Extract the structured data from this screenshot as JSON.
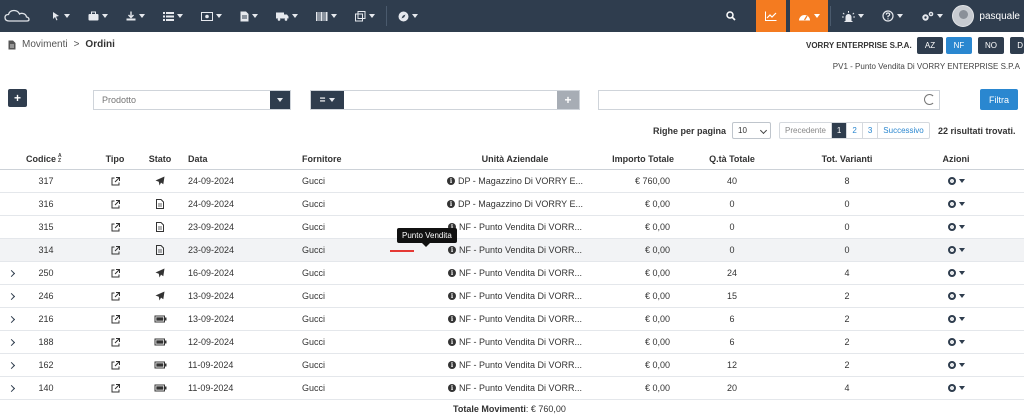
{
  "nav": {
    "user_name": "pasquale"
  },
  "breadcrumb": {
    "parent": "Movimenti",
    "separator": ">",
    "current": "Ordini"
  },
  "company": {
    "name": "VORRY ENTERPRISE S.P.A.",
    "store": "PV1 - Punto Vendita Di VORRY ENTERPRISE S.P.A",
    "buttons": [
      "AZ",
      "NF",
      "NO",
      "D"
    ]
  },
  "filters": {
    "add_label": "+",
    "product_placeholder": "Prodotto",
    "operator_label": "=",
    "plus_label": "+",
    "filter_button": "Filtra"
  },
  "pagination": {
    "rows_label": "Righe per pagina",
    "rows_value": "10",
    "prev_label": "Precedente",
    "pages": [
      "1",
      "2",
      "3"
    ],
    "next_label": "Successivo",
    "results_text": "22 risultati trovati."
  },
  "table": {
    "columns": {
      "codice": "Codice",
      "tipo": "Tipo",
      "stato": "Stato",
      "data": "Data",
      "fornitore": "Fornitore",
      "unita": "Unità Aziendale",
      "importo": "Importo Totale",
      "qta": "Q.tà Totale",
      "varianti": "Tot. Varianti",
      "azioni": "Azioni"
    },
    "rows": [
      {
        "codice": "317",
        "stato": "send",
        "data": "24-09-2024",
        "fornitore": "Gucci",
        "unita": "DP - Magazzino Di VORRY E...",
        "importo": "€ 760,00",
        "qta": "40",
        "varianti": "8",
        "expandable": false
      },
      {
        "codice": "316",
        "stato": "document",
        "data": "24-09-2024",
        "fornitore": "Gucci",
        "unita": "DP - Magazzino Di VORRY E...",
        "importo": "€ 0,00",
        "qta": "0",
        "varianti": "0",
        "expandable": false
      },
      {
        "codice": "315",
        "stato": "document",
        "data": "23-09-2024",
        "fornitore": "Gucci",
        "unita": "NF - Punto Vendita Di VORR...",
        "importo": "€ 0,00",
        "qta": "0",
        "varianti": "0",
        "expandable": false
      },
      {
        "codice": "314",
        "stato": "document",
        "data": "23-09-2024",
        "fornitore": "Gucci",
        "unita": "NF - Punto Vendita Di VORR...",
        "importo": "€ 0,00",
        "qta": "0",
        "varianti": "0",
        "expandable": false
      },
      {
        "codice": "250",
        "stato": "send",
        "data": "16-09-2024",
        "fornitore": "Gucci",
        "unita": "NF - Punto Vendita Di VORR...",
        "importo": "€ 0,00",
        "qta": "24",
        "varianti": "4",
        "expandable": true
      },
      {
        "codice": "246",
        "stato": "send",
        "data": "13-09-2024",
        "fornitore": "Gucci",
        "unita": "NF - Punto Vendita Di VORR...",
        "importo": "€ 0,00",
        "qta": "15",
        "varianti": "2",
        "expandable": true
      },
      {
        "codice": "216",
        "stato": "battery",
        "data": "13-09-2024",
        "fornitore": "Gucci",
        "unita": "NF - Punto Vendita Di VORR...",
        "importo": "€ 0,00",
        "qta": "6",
        "varianti": "2",
        "expandable": true
      },
      {
        "codice": "188",
        "stato": "battery",
        "data": "12-09-2024",
        "fornitore": "Gucci",
        "unita": "NF - Punto Vendita Di VORR...",
        "importo": "€ 0,00",
        "qta": "6",
        "varianti": "2",
        "expandable": true
      },
      {
        "codice": "162",
        "stato": "battery",
        "data": "11-09-2024",
        "fornitore": "Gucci",
        "unita": "NF - Punto Vendita Di VORR...",
        "importo": "€ 0,00",
        "qta": "12",
        "varianti": "2",
        "expandable": true
      },
      {
        "codice": "140",
        "stato": "battery",
        "data": "11-09-2024",
        "fornitore": "Gucci",
        "unita": "NF - Punto Vendita Di VORR...",
        "importo": "€ 0,00",
        "qta": "20",
        "varianti": "4",
        "expandable": true
      }
    ]
  },
  "tooltip": {
    "text": "Punto Vendita"
  },
  "footer": {
    "total_label": "Totale Movimenti",
    "total_value": ": € 760,00"
  },
  "colors": {
    "nav_bg": "#2f3d4e",
    "accent_orange": "#f47b20",
    "accent_blue": "#2a87d0"
  }
}
